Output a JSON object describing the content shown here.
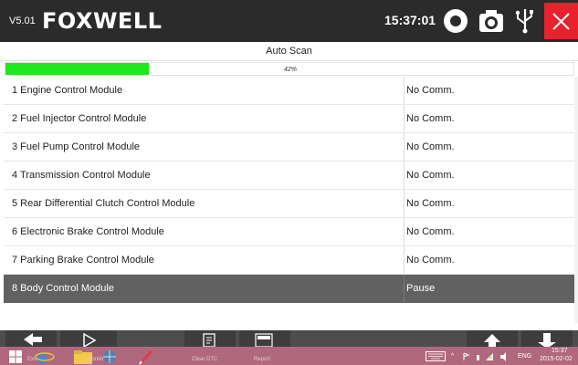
{
  "header": {
    "version": "V5.01",
    "logo": "FOXWELL",
    "time": "15:37:01",
    "icons": [
      "record-icon",
      "camera-icon",
      "usb-icon",
      "close-icon"
    ],
    "close_color": "#e8212d"
  },
  "title": "Auto Scan",
  "progress": {
    "label": "42%",
    "value": 42,
    "fill_color": "#1ee81e"
  },
  "modules": [
    {
      "label": "1  Engine Control Module",
      "status": "No Comm."
    },
    {
      "label": "2  Fuel Injector Control Module",
      "status": "No Comm."
    },
    {
      "label": "3  Fuel Pump Control Module",
      "status": "No Comm."
    },
    {
      "label": "4  Transmission Control Module",
      "status": "No Comm."
    },
    {
      "label": "5  Rear Differential Clutch Control Module",
      "status": "No Comm."
    },
    {
      "label": "6  Electronic Brake Control Module",
      "status": "No Comm."
    },
    {
      "label": "7  Parking Brake Control Module",
      "status": "No Comm."
    },
    {
      "label": "8  Body Control Module",
      "status": "Pause"
    }
  ],
  "toolbar": {
    "buttons": [
      "back-icon",
      "play-icon",
      "clear-dtc-icon",
      "report-icon",
      "up-icon",
      "download-icon"
    ],
    "labels": {
      "exit": "Exit",
      "continue": "Continue",
      "clear_dtc": "Clear DTC",
      "report": "Report"
    }
  },
  "taskbar": {
    "language": "ENG",
    "clock_time": "15:37",
    "clock_date": "2015-02-02",
    "color": "#b0687e"
  }
}
